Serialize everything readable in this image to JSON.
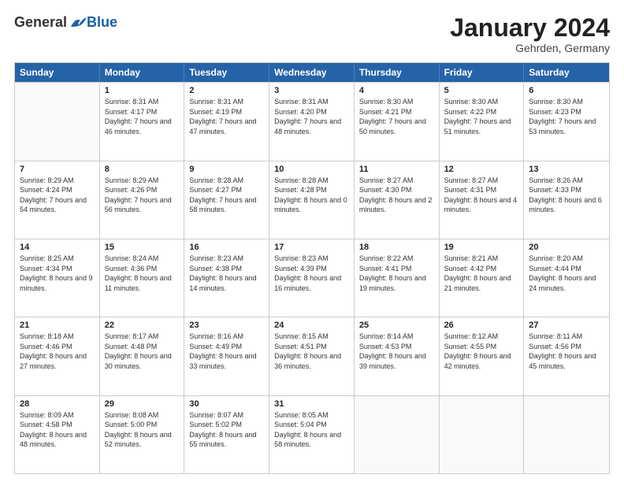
{
  "header": {
    "logo_general": "General",
    "logo_blue": "Blue",
    "month_title": "January 2024",
    "subtitle": "Gehrden, Germany"
  },
  "days_of_week": [
    "Sunday",
    "Monday",
    "Tuesday",
    "Wednesday",
    "Thursday",
    "Friday",
    "Saturday"
  ],
  "weeks": [
    [
      {
        "day": "",
        "empty": true
      },
      {
        "day": "1",
        "sunrise": "Sunrise: 8:31 AM",
        "sunset": "Sunset: 4:17 PM",
        "daylight": "Daylight: 7 hours and 46 minutes."
      },
      {
        "day": "2",
        "sunrise": "Sunrise: 8:31 AM",
        "sunset": "Sunset: 4:19 PM",
        "daylight": "Daylight: 7 hours and 47 minutes."
      },
      {
        "day": "3",
        "sunrise": "Sunrise: 8:31 AM",
        "sunset": "Sunset: 4:20 PM",
        "daylight": "Daylight: 7 hours and 48 minutes."
      },
      {
        "day": "4",
        "sunrise": "Sunrise: 8:30 AM",
        "sunset": "Sunset: 4:21 PM",
        "daylight": "Daylight: 7 hours and 50 minutes."
      },
      {
        "day": "5",
        "sunrise": "Sunrise: 8:30 AM",
        "sunset": "Sunset: 4:22 PM",
        "daylight": "Daylight: 7 hours and 51 minutes."
      },
      {
        "day": "6",
        "sunrise": "Sunrise: 8:30 AM",
        "sunset": "Sunset: 4:23 PM",
        "daylight": "Daylight: 7 hours and 53 minutes."
      }
    ],
    [
      {
        "day": "7",
        "sunrise": "Sunrise: 8:29 AM",
        "sunset": "Sunset: 4:24 PM",
        "daylight": "Daylight: 7 hours and 54 minutes."
      },
      {
        "day": "8",
        "sunrise": "Sunrise: 8:29 AM",
        "sunset": "Sunset: 4:26 PM",
        "daylight": "Daylight: 7 hours and 56 minutes."
      },
      {
        "day": "9",
        "sunrise": "Sunrise: 8:28 AM",
        "sunset": "Sunset: 4:27 PM",
        "daylight": "Daylight: 7 hours and 58 minutes."
      },
      {
        "day": "10",
        "sunrise": "Sunrise: 8:28 AM",
        "sunset": "Sunset: 4:28 PM",
        "daylight": "Daylight: 8 hours and 0 minutes."
      },
      {
        "day": "11",
        "sunrise": "Sunrise: 8:27 AM",
        "sunset": "Sunset: 4:30 PM",
        "daylight": "Daylight: 8 hours and 2 minutes."
      },
      {
        "day": "12",
        "sunrise": "Sunrise: 8:27 AM",
        "sunset": "Sunset: 4:31 PM",
        "daylight": "Daylight: 8 hours and 4 minutes."
      },
      {
        "day": "13",
        "sunrise": "Sunrise: 8:26 AM",
        "sunset": "Sunset: 4:33 PM",
        "daylight": "Daylight: 8 hours and 6 minutes."
      }
    ],
    [
      {
        "day": "14",
        "sunrise": "Sunrise: 8:25 AM",
        "sunset": "Sunset: 4:34 PM",
        "daylight": "Daylight: 8 hours and 9 minutes."
      },
      {
        "day": "15",
        "sunrise": "Sunrise: 8:24 AM",
        "sunset": "Sunset: 4:36 PM",
        "daylight": "Daylight: 8 hours and 11 minutes."
      },
      {
        "day": "16",
        "sunrise": "Sunrise: 8:23 AM",
        "sunset": "Sunset: 4:38 PM",
        "daylight": "Daylight: 8 hours and 14 minutes."
      },
      {
        "day": "17",
        "sunrise": "Sunrise: 8:23 AM",
        "sunset": "Sunset: 4:39 PM",
        "daylight": "Daylight: 8 hours and 16 minutes."
      },
      {
        "day": "18",
        "sunrise": "Sunrise: 8:22 AM",
        "sunset": "Sunset: 4:41 PM",
        "daylight": "Daylight: 8 hours and 19 minutes."
      },
      {
        "day": "19",
        "sunrise": "Sunrise: 8:21 AM",
        "sunset": "Sunset: 4:42 PM",
        "daylight": "Daylight: 8 hours and 21 minutes."
      },
      {
        "day": "20",
        "sunrise": "Sunrise: 8:20 AM",
        "sunset": "Sunset: 4:44 PM",
        "daylight": "Daylight: 8 hours and 24 minutes."
      }
    ],
    [
      {
        "day": "21",
        "sunrise": "Sunrise: 8:18 AM",
        "sunset": "Sunset: 4:46 PM",
        "daylight": "Daylight: 8 hours and 27 minutes."
      },
      {
        "day": "22",
        "sunrise": "Sunrise: 8:17 AM",
        "sunset": "Sunset: 4:48 PM",
        "daylight": "Daylight: 8 hours and 30 minutes."
      },
      {
        "day": "23",
        "sunrise": "Sunrise: 8:16 AM",
        "sunset": "Sunset: 4:49 PM",
        "daylight": "Daylight: 8 hours and 33 minutes."
      },
      {
        "day": "24",
        "sunrise": "Sunrise: 8:15 AM",
        "sunset": "Sunset: 4:51 PM",
        "daylight": "Daylight: 8 hours and 36 minutes."
      },
      {
        "day": "25",
        "sunrise": "Sunrise: 8:14 AM",
        "sunset": "Sunset: 4:53 PM",
        "daylight": "Daylight: 8 hours and 39 minutes."
      },
      {
        "day": "26",
        "sunrise": "Sunrise: 8:12 AM",
        "sunset": "Sunset: 4:55 PM",
        "daylight": "Daylight: 8 hours and 42 minutes."
      },
      {
        "day": "27",
        "sunrise": "Sunrise: 8:11 AM",
        "sunset": "Sunset: 4:56 PM",
        "daylight": "Daylight: 8 hours and 45 minutes."
      }
    ],
    [
      {
        "day": "28",
        "sunrise": "Sunrise: 8:09 AM",
        "sunset": "Sunset: 4:58 PM",
        "daylight": "Daylight: 8 hours and 48 minutes."
      },
      {
        "day": "29",
        "sunrise": "Sunrise: 8:08 AM",
        "sunset": "Sunset: 5:00 PM",
        "daylight": "Daylight: 8 hours and 52 minutes."
      },
      {
        "day": "30",
        "sunrise": "Sunrise: 8:07 AM",
        "sunset": "Sunset: 5:02 PM",
        "daylight": "Daylight: 8 hours and 55 minutes."
      },
      {
        "day": "31",
        "sunrise": "Sunrise: 8:05 AM",
        "sunset": "Sunset: 5:04 PM",
        "daylight": "Daylight: 8 hours and 58 minutes."
      },
      {
        "day": "",
        "empty": true
      },
      {
        "day": "",
        "empty": true
      },
      {
        "day": "",
        "empty": true
      }
    ]
  ]
}
